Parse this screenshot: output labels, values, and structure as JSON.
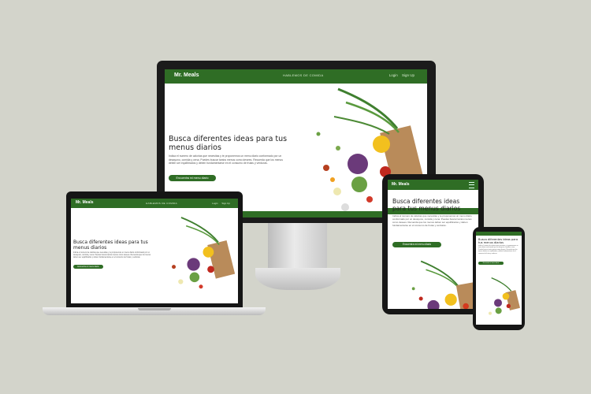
{
  "site": {
    "brand": "Mr. Meals",
    "menu": "HABLEMOS DE COMIDA",
    "login": "Login",
    "signup": "Sign Up",
    "title": "Busca diferentes ideas para tus menus diarios",
    "description": "Indica el numero de calorias que necesitas y te proponemos un menu diario conformado por un desayuno, comida y cena. Puedes buscar tantos menus como desees. Recuerda que los menus deben ser equilibrados y deben fundamentarse en el consumo de frutas y verduras.",
    "cta": "Encuentra mi menu diario"
  },
  "colors": {
    "brand_green": "#2f6d25",
    "background": "#d3d4cb"
  },
  "icons": {
    "mobile_menu": "hamburger-icon"
  }
}
